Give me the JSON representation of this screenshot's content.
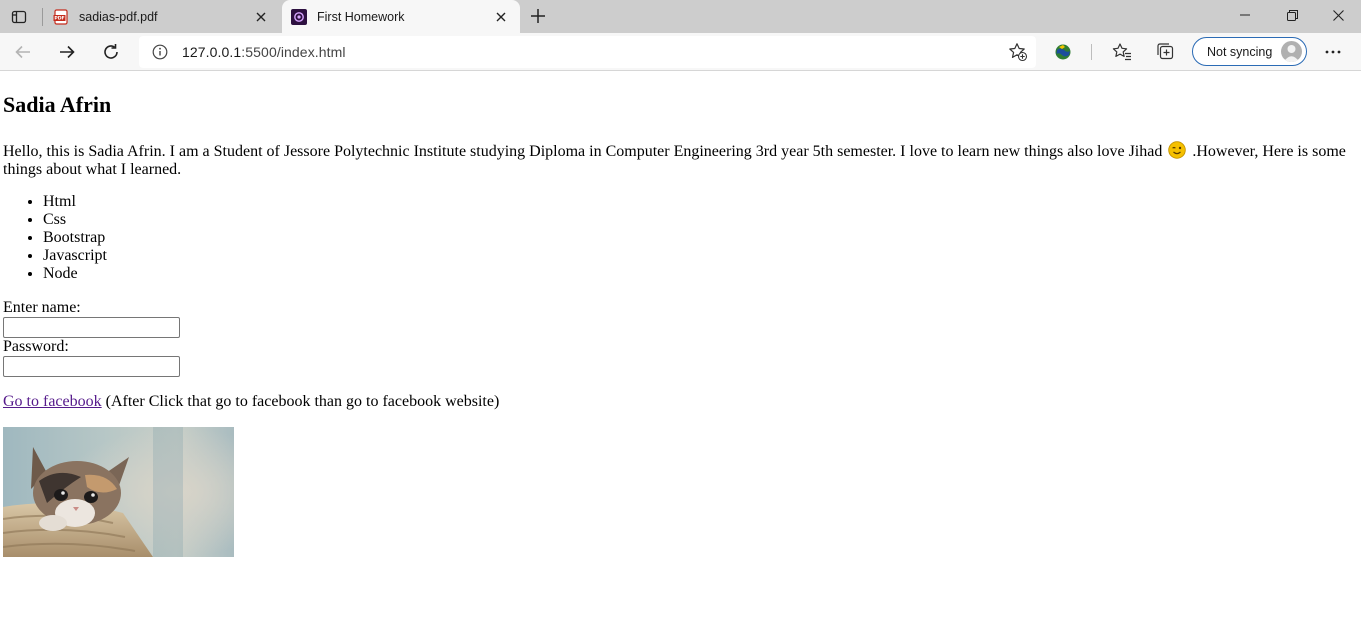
{
  "browser": {
    "tabs": [
      {
        "title": "sadias-pdf.pdf",
        "active": false,
        "icon": "pdf-file-icon"
      },
      {
        "title": "First Homework",
        "active": true,
        "icon": "site-favicon-icon"
      }
    ],
    "url": {
      "host": "127.0.0.1",
      "rest": ":5500/index.html"
    },
    "sync_label": "Not syncing",
    "colors": {
      "chrome": "#cdcdcd",
      "toolbar": "#f7f7f7",
      "sync_border": "#2b6bb5",
      "link": "#551a8b"
    }
  },
  "page": {
    "heading": "Sadia Afrin",
    "intro_before": "Hello, this is Sadia Afrin. I am a Student of Jessore Polytechnic Institute studying Diploma in Computer Engineering 3rd year 5th semester. I love to learn new things also love Jihad",
    "intro_after": ".However, Here is some things about what I learned.",
    "skills": [
      "Html",
      "Css",
      "Bootstrap",
      "Javascript",
      "Node"
    ],
    "form": {
      "name_label": "Enter name:",
      "name_value": "",
      "password_label": "Password:",
      "password_value": ""
    },
    "link_text": "Go to facebook",
    "link_note": "(After Click that go to facebook than go to facebook website)",
    "image": {
      "subject": "kitten-photo"
    }
  }
}
